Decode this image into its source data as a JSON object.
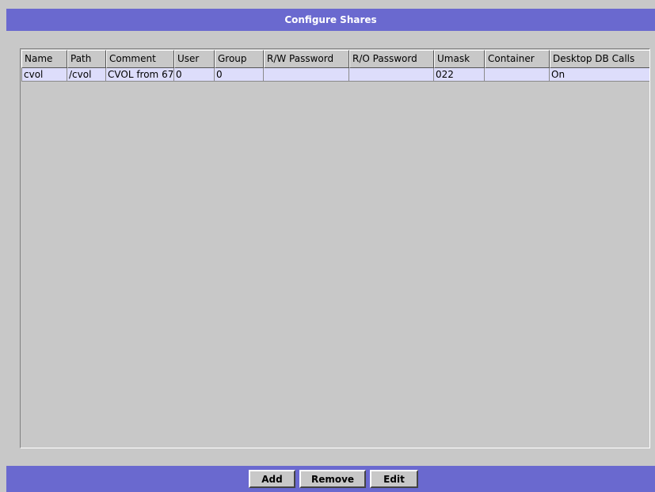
{
  "window": {
    "title": "Configure Shares"
  },
  "table": {
    "columns": [
      "Name",
      "Path",
      "Comment",
      "User",
      "Group",
      "R/W Password",
      "R/O Password",
      "Umask",
      "Container",
      "Desktop DB Calls"
    ],
    "rows": [
      [
        "cvol",
        "/cvol",
        "CVOL from 67",
        "0",
        "0",
        "",
        "",
        "022",
        "",
        "On"
      ]
    ]
  },
  "buttons": {
    "add": "Add",
    "remove": "Remove",
    "edit": "Edit"
  },
  "colors": {
    "title_bar": "#6a69cf",
    "selected_row": "#ddddfb",
    "panel": "#c8c8c8"
  }
}
